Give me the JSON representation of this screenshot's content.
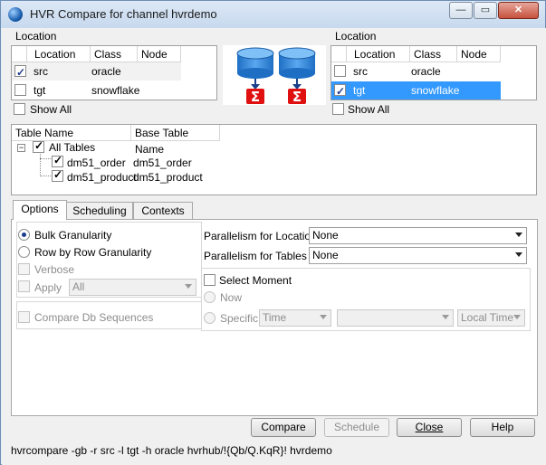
{
  "window": {
    "title": "HVR Compare for channel hvrdemo",
    "minimize_glyph": "—",
    "maximize_glyph": "▭",
    "close_glyph": "✕"
  },
  "left_location": {
    "group_label": "Location",
    "headers": [
      "Location",
      "Class",
      "Node"
    ],
    "rows": [
      {
        "location": "src",
        "class": "oracle",
        "node": "",
        "checked": true
      },
      {
        "location": "tgt",
        "class": "snowflake",
        "node": "",
        "checked": false
      }
    ],
    "show_all_label": "Show All"
  },
  "right_location": {
    "group_label": "Location",
    "headers": [
      "Location",
      "Class",
      "Node"
    ],
    "rows": [
      {
        "location": "src",
        "class": "oracle",
        "node": "",
        "checked": false
      },
      {
        "location": "tgt",
        "class": "snowflake",
        "node": "",
        "checked": true,
        "selected": true
      }
    ],
    "show_all_label": "Show All"
  },
  "compare_graphic": {
    "icon": "database-to-sigma-icon"
  },
  "tables": {
    "headers": [
      "Table Name",
      "Base Table Name"
    ],
    "root_label": "All Tables",
    "items": [
      {
        "name": "dm51_order",
        "base": "dm51_order"
      },
      {
        "name": "dm51_product",
        "base": "dm51_product"
      }
    ]
  },
  "tabs": [
    "Options",
    "Scheduling",
    "Contexts"
  ],
  "options": {
    "bulk_label": "Bulk Granularity",
    "row_label": "Row by Row Granularity",
    "verbose_label": "Verbose",
    "apply_label": "Apply",
    "apply_value": "All",
    "compare_seq_label": "Compare Db Sequences",
    "par_locations_label": "Parallelism for Locations",
    "par_locations_value": "None",
    "par_tables_label": "Parallelism for Tables",
    "par_tables_value": "None",
    "select_moment_label": "Select Moment",
    "now_label": "Now",
    "specific_label": "Specific",
    "time_value": "Time",
    "time_input_value": "",
    "timezone_value": "Local Time"
  },
  "buttons": {
    "compare": "Compare",
    "schedule": "Schedule",
    "close": "Close",
    "help": "Help"
  },
  "status_command": "hvrcompare -gb -r src -l tgt -h oracle hvrhub/!{Qb/Q.KqR}! hvrdemo"
}
